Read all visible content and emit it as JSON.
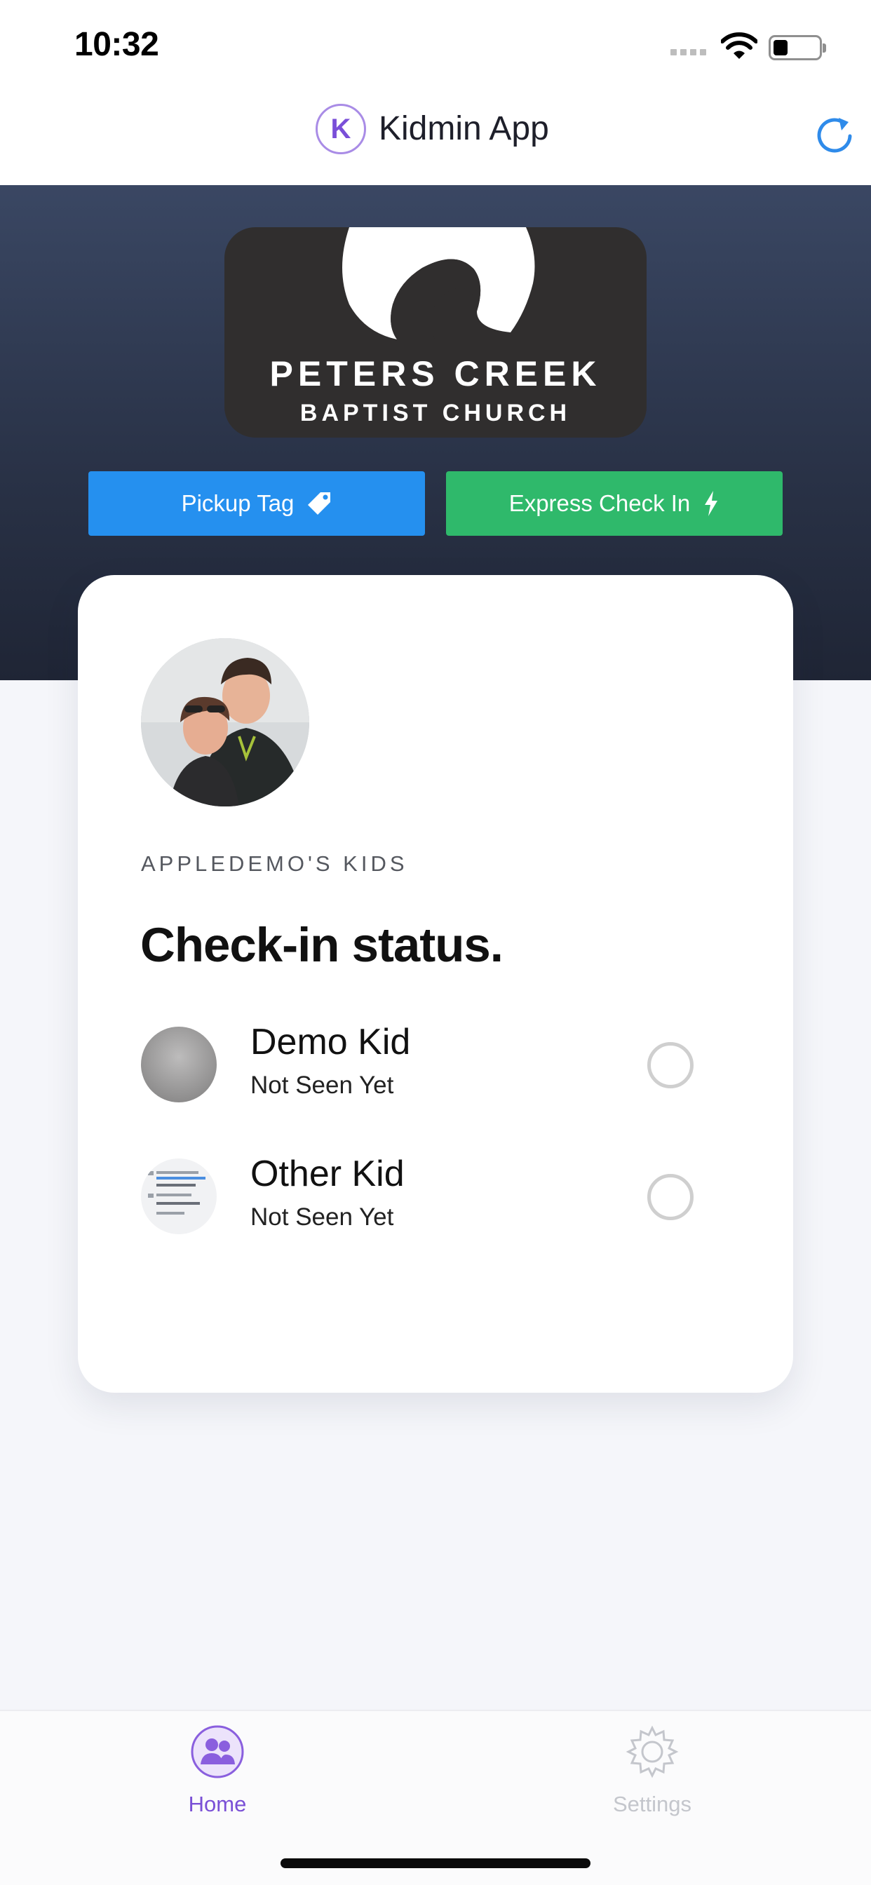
{
  "status_bar": {
    "time": "10:32"
  },
  "header": {
    "logo_letter": "K",
    "title": "Kidmin App"
  },
  "hero": {
    "church_name_line1": "PETERS CREEK",
    "church_name_line2": "BAPTIST CHURCH",
    "pickup_button": "Pickup Tag",
    "express_button": "Express Check In"
  },
  "card": {
    "eyebrow": "APPLEDEMO'S KIDS",
    "title": "Check-in status.",
    "kids": [
      {
        "name": "Demo Kid",
        "status": "Not Seen Yet"
      },
      {
        "name": "Other Kid",
        "status": "Not Seen Yet"
      }
    ]
  },
  "tabs": {
    "home": "Home",
    "settings": "Settings"
  },
  "colors": {
    "accent_purple": "#7a50d6",
    "pickup_blue": "#2590ef",
    "express_green": "#2fb96b",
    "refresh_blue": "#2f8bea",
    "hero_dark": "#2a3348"
  },
  "icons": {
    "pickup": "tag-icon",
    "express": "bolt-icon",
    "refresh": "refresh-icon",
    "home": "people-icon",
    "settings": "gear-icon"
  }
}
